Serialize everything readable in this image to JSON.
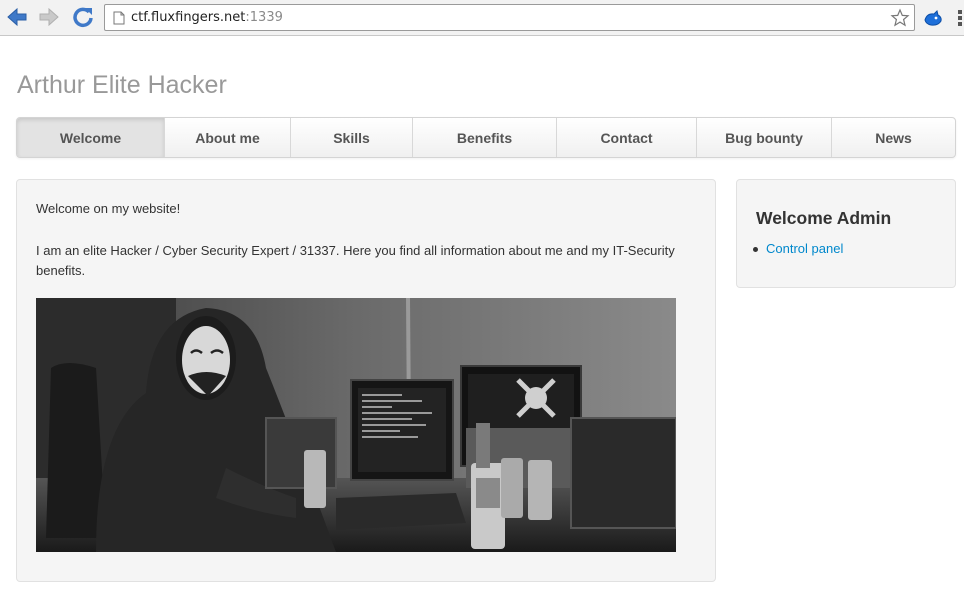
{
  "browser": {
    "url_host": "ctf.fluxfingers.net",
    "url_port": ":1339",
    "icons": [
      "back-arrow-icon",
      "forward-arrow-icon",
      "reload-icon",
      "page-icon",
      "star-icon",
      "extension-icon",
      "menu-icon"
    ]
  },
  "site": {
    "title": "Arthur Elite Hacker"
  },
  "nav": {
    "items": [
      {
        "label": "Welcome",
        "active": true
      },
      {
        "label": "About me",
        "active": false
      },
      {
        "label": "Skills",
        "active": false
      },
      {
        "label": "Benefits",
        "active": false
      },
      {
        "label": "Contact",
        "active": false
      },
      {
        "label": "Bug bounty",
        "active": false
      },
      {
        "label": "News",
        "active": false
      }
    ]
  },
  "main": {
    "paragraph1": "Welcome on my website!",
    "paragraph2": "I am an elite Hacker / Cyber Security Expert / 31337. Here you find all information about me and my IT-Security benefits.",
    "image_alt": ""
  },
  "sidebar": {
    "title": "Welcome Admin",
    "links": [
      {
        "label": "Control panel"
      }
    ]
  },
  "colors": {
    "link": "#0088cc",
    "title_gray": "#999999",
    "well_bg": "#f5f5f5"
  }
}
